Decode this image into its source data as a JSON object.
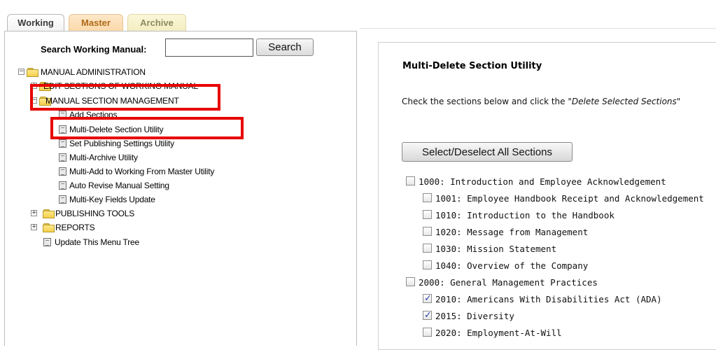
{
  "tabs": [
    {
      "label": "Working",
      "active": true
    },
    {
      "label": "Master",
      "active": false
    },
    {
      "label": "Archive",
      "active": false
    }
  ],
  "search": {
    "label": "Search Working Manual:",
    "value": "",
    "button_label": "Search"
  },
  "tree": {
    "manual_admin": "MANUAL ADMINISTRATION",
    "edit_sections": "EDIT SECTIONS OF WORKING MANUAL",
    "section_mgmt": "MANUAL SECTION MANAGEMENT",
    "add_sections": "Add Sections",
    "multi_delete": "Multi-Delete Section Utility",
    "publishing_settings": "Set Publishing Settings Utility",
    "multi_archive": "Multi-Archive Utility",
    "multi_add": "Multi-Add to Working From Master Utility",
    "auto_revise": "Auto Revise Manual Setting",
    "multi_key": "Multi-Key Fields Update",
    "publishing_tools": "PUBLISHING TOOLS",
    "reports": "REPORTS",
    "update_tree": "Update This Menu Tree",
    "toggle_expanded": "−",
    "toggle_collapsed": "+"
  },
  "panel": {
    "title": "Multi-Delete Section Utility",
    "instructions_prefix": "Check the sections below and click the ",
    "instructions_italic": "\"Delete Selected Sections\"",
    "select_all_label": "Select/Deselect All Sections",
    "sections": [
      {
        "label": "1000: Introduction and Employee Acknowledgement",
        "checked": false
      },
      {
        "label": "1001: Employee Handbook Receipt and Acknowledgement",
        "checked": false
      },
      {
        "label": "1010: Introduction to the Handbook",
        "checked": false
      },
      {
        "label": "1020: Message from Management",
        "checked": false
      },
      {
        "label": "1030: Mission Statement",
        "checked": false
      },
      {
        "label": "1040: Overview of the Company",
        "checked": false
      },
      {
        "label": "2000: General Management Practices",
        "checked": false
      },
      {
        "label": "2010: Americans With Disabilities Act (ADA)",
        "checked": true
      },
      {
        "label": "2015: Diversity",
        "checked": true
      },
      {
        "label": "2020: Employment-At-Will",
        "checked": false
      }
    ]
  },
  "colors": {
    "highlight": "#e80000",
    "checkmark": "#2b3fa6",
    "folder": "#f3cf4c"
  }
}
